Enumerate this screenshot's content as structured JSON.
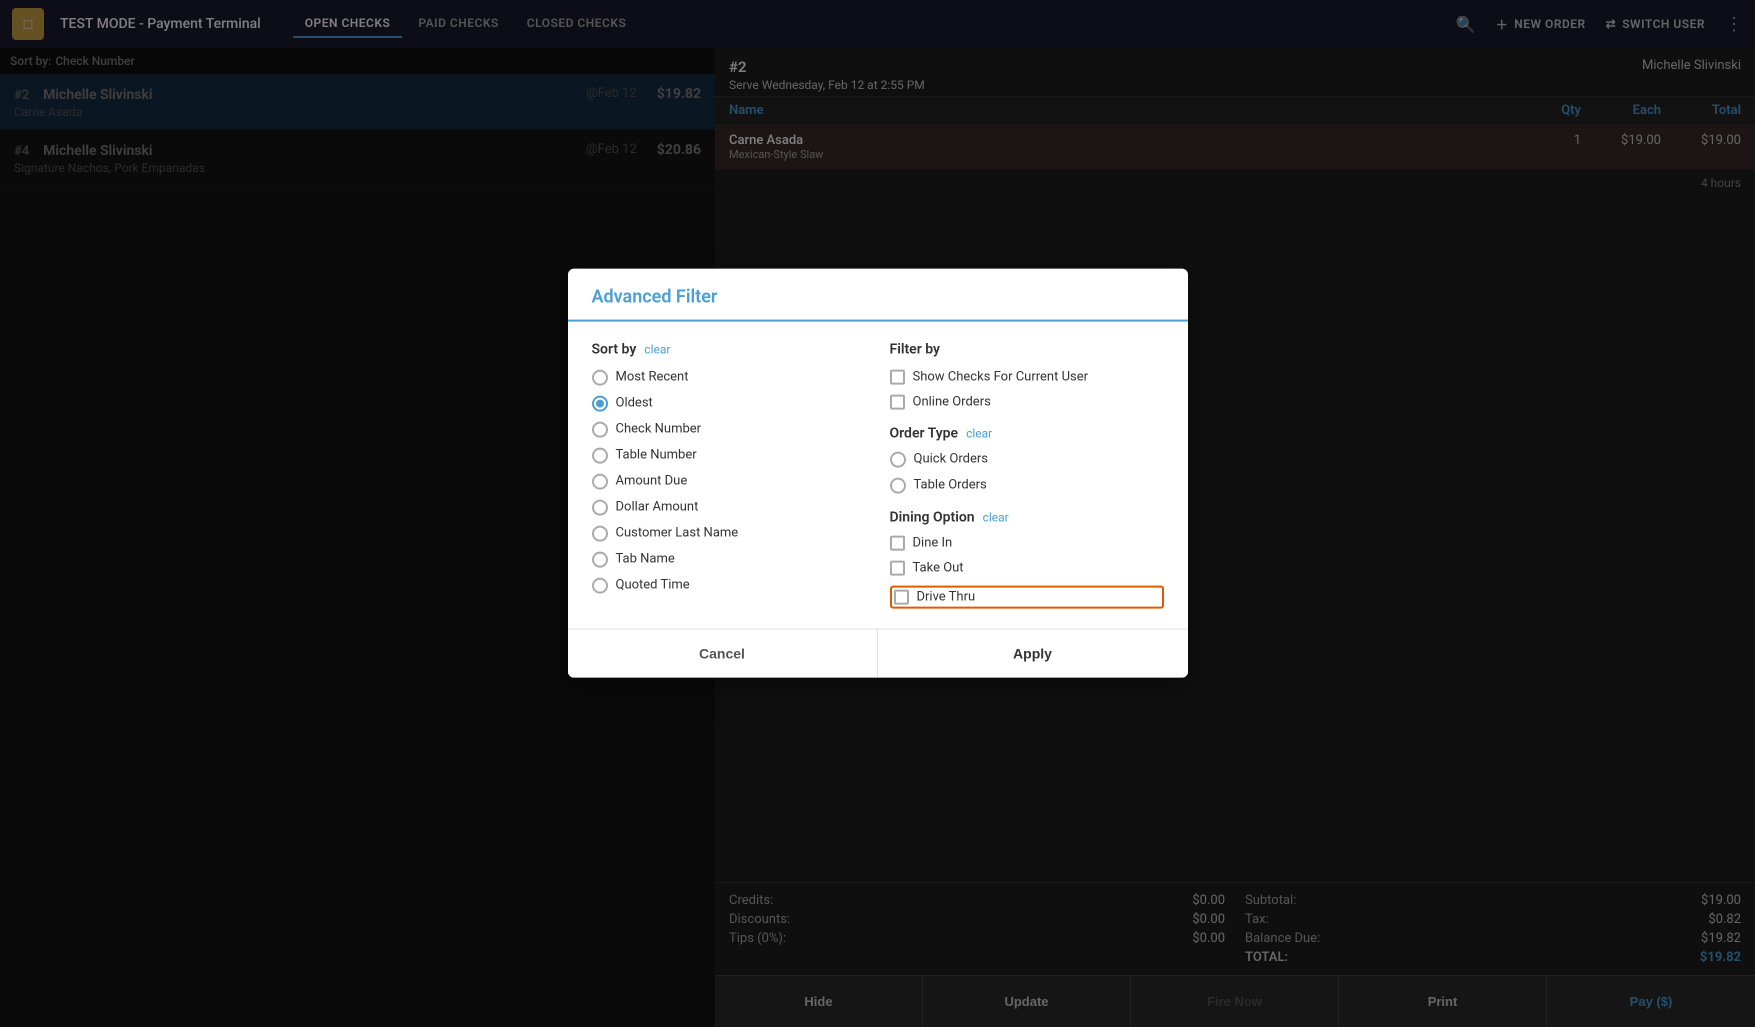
{
  "header": {
    "logo_text": "□",
    "title": "TEST MODE - Payment Terminal",
    "nav": [
      {
        "label": "OPEN CHECKS",
        "active": true
      },
      {
        "label": "PAID CHECKS",
        "active": false
      },
      {
        "label": "CLOSED CHECKS",
        "active": false
      }
    ],
    "actions": [
      {
        "label": "NEW ORDER",
        "icon": "+"
      },
      {
        "label": "SWITCH USER",
        "icon": "⇄"
      },
      {
        "label": "MORE",
        "icon": "⋮"
      }
    ]
  },
  "sort_bar": {
    "prefix": "Sort by:",
    "value": "Check Number"
  },
  "checks": [
    {
      "number": "#2",
      "name": "Michelle Slivinski",
      "date": "@Feb 12",
      "amount": "$19.82",
      "items": "Carne Asada",
      "selected": true
    },
    {
      "number": "#4",
      "name": "Michelle Slivinski",
      "date": "@Feb 12",
      "amount": "$20.86",
      "items": "Signature Nachos, Pork Empanadas",
      "selected": false
    }
  ],
  "detail": {
    "check_number": "#2",
    "server": "Michelle Slivinski",
    "serve_time": "Serve Wednesday, Feb 12 at 2:55 PM",
    "columns": [
      "Name",
      "Qty",
      "Each",
      "Total"
    ],
    "order_items": [
      {
        "name": "Carne Asada",
        "sub": "Mexican-Style Slaw",
        "qty": "1",
        "each": "$19.00",
        "total": "$19.00",
        "highlighted": true
      }
    ],
    "time_ago": "4 hours",
    "totals": {
      "credits_label": "Credits:",
      "credits_value": "$0.00",
      "subtotal_label": "Subtotal:",
      "subtotal_value": "$19.00",
      "discounts_label": "Discounts:",
      "discounts_value": "$0.00",
      "tax_label": "Tax:",
      "tax_value": "$0.82",
      "tips_label": "Tips (0%):",
      "tips_value": "$0.00",
      "balance_label": "Balance Due:",
      "balance_value": "$19.82",
      "total_label": "TOTAL:",
      "total_value": "$19.82"
    },
    "actions": [
      "Hide",
      "Update",
      "Fire Now",
      "Print",
      "Pay ($)"
    ]
  },
  "dialog": {
    "title": "Advanced Filter",
    "sort_section": {
      "label": "Sort by",
      "clear_label": "clear",
      "options": [
        {
          "label": "Most Recent",
          "selected": false
        },
        {
          "label": "Oldest",
          "selected": true
        },
        {
          "label": "Check Number",
          "selected": false
        },
        {
          "label": "Table Number",
          "selected": false
        },
        {
          "label": "Amount Due",
          "selected": false
        },
        {
          "label": "Dollar Amount",
          "selected": false
        },
        {
          "label": "Customer Last Name",
          "selected": false
        },
        {
          "label": "Tab Name",
          "selected": false
        },
        {
          "label": "Quoted Time",
          "selected": false
        }
      ]
    },
    "filter_section": {
      "label": "Filter by",
      "options": [
        {
          "label": "Show Checks For Current User",
          "checked": false
        },
        {
          "label": "Online Orders",
          "checked": false
        }
      ]
    },
    "order_type_section": {
      "label": "Order Type",
      "clear_label": "clear",
      "options": [
        {
          "label": "Quick Orders",
          "selected": false
        },
        {
          "label": "Table Orders",
          "selected": false
        }
      ]
    },
    "dining_option_section": {
      "label": "Dining Option",
      "clear_label": "clear",
      "options": [
        {
          "label": "Dine In",
          "checked": false
        },
        {
          "label": "Take Out",
          "checked": false
        },
        {
          "label": "Drive Thru",
          "checked": false,
          "highlighted": true
        }
      ]
    },
    "cancel_label": "Cancel",
    "apply_label": "Apply"
  }
}
